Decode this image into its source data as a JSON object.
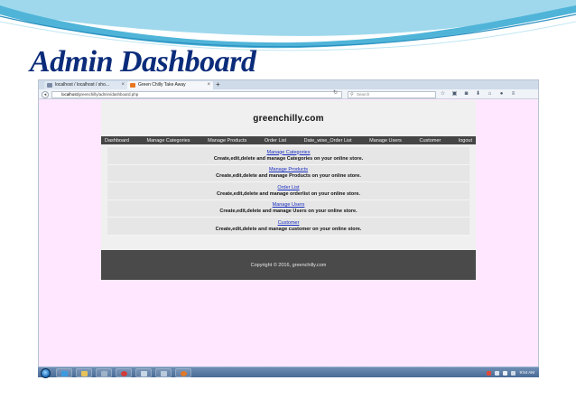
{
  "slide": {
    "title": "Admin Dashboard"
  },
  "browser": {
    "tabs": [
      {
        "label": "localhost / localhost / sho...",
        "active": false
      },
      {
        "label": "Green Chilly Take Away",
        "active": true
      }
    ],
    "new_tab": "+",
    "tab_close": "×",
    "url_host": "localhost",
    "url_path": "/greenchilly/admin/dashboard.php",
    "search_placeholder": "Search",
    "icons": [
      "star-icon",
      "clipboard-icon",
      "pocket-icon",
      "download-icon",
      "home-icon",
      "chat-icon",
      "menu-icon"
    ]
  },
  "site": {
    "title": "greenchilly.com",
    "nav": [
      "Dashboard",
      "Manage Categories",
      "Manage Products",
      "Order List",
      "Date_wise_Order List",
      "Manage Users",
      "Customer",
      "logout"
    ],
    "cards": [
      {
        "link": "Manage Categories",
        "desc": "Create,edit,delete and manage Categories on your online store."
      },
      {
        "link": "Manage Products",
        "desc": "Create,edit,delete and manage Products on your online store."
      },
      {
        "link": "Order List",
        "desc": "Create,edit,delete and manage orderlist on your online store."
      },
      {
        "link": "Manage Users",
        "desc": "Create,edit,delete and manage Users on your online store."
      },
      {
        "link": "Customer",
        "desc": "Create,edit,delete and manage customer on your online store."
      }
    ],
    "footer": "Copyright © 2016, greenchilly.com"
  },
  "taskbar": {
    "clock": "9:54 AM",
    "colors": {
      "accent": "#0b2c7a",
      "nav_bg": "#454545",
      "page_bg": "#ffe8ff"
    }
  }
}
